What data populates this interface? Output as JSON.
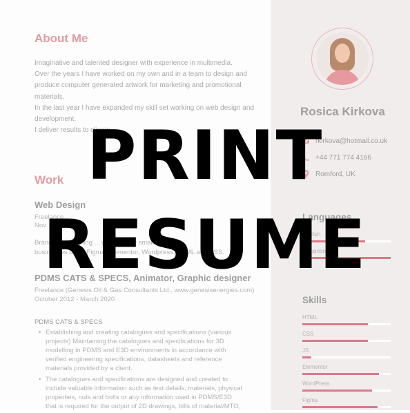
{
  "about": {
    "title": "About Me",
    "lines": [
      "Imaginative and talented designer with experience in multimedia.",
      "Over the years I have worked on my own and in a team to design and",
      "produce computer generated artwork for marketing and promotional",
      "materials.",
      "In the last year I have expanded my skill set working on web design and",
      "development.",
      "I deliver results to clients"
    ]
  },
  "work": {
    "title": "Work",
    "jobs": [
      {
        "title": "Web Design",
        "company": "Freelance",
        "dates": "Nov",
        "desc_lines": [
          "Branding, designing ... websites for small",
          "businesses using Figma, Elementor, Wordpress, HTML and CSS."
        ]
      },
      {
        "title": "PDMS CATS & SPECS, Animator, Graphic designer",
        "company": "Freelance (Genesis Oil & Gas Consultants Ltd., www.genesisenergies.com)",
        "dates": "October 2012 -  March 2020"
      }
    ],
    "bullets_heading": "PDMS CATS & SPECS",
    "bullets": [
      [
        "Establishing and creating catalogues and specifications (various",
        "projects) Maintaining the catalogues and specifications for 3D",
        "modelling in PDMS and E3D environments in accordance with",
        "verified engineering specifications, datasheets and reference",
        "materials provided by a client."
      ],
      [
        "The catalogues and specifications are designed and created to",
        "include valuable information such as text details, materials, physical",
        "properties, nuts and bolts or any information used in PDMS/E3D",
        "that is required for the output of 2D drawings, bills of material/MTO,"
      ]
    ]
  },
  "profile": {
    "name": "Rosica Kirkova",
    "email": "rkirkova@hotmail.co.uk",
    "phone": "+44 771 774 4166",
    "location": "Romford, UK",
    "accent": "#d97a87"
  },
  "languages": {
    "title": "Languages",
    "items": [
      {
        "label": "English",
        "level": 0.71
      },
      {
        "label": "Bulgarian",
        "level": 1.0
      }
    ]
  },
  "skills": {
    "title": "Skills",
    "items": [
      {
        "label": "HTML",
        "level": 0.74
      },
      {
        "label": "CSS",
        "level": 0.74
      },
      {
        "label": "JS",
        "level": 0.1
      },
      {
        "label": "Elementor",
        "level": 0.87
      },
      {
        "label": "WordPress",
        "level": 0.79
      },
      {
        "label": "Figma",
        "level": 0.85
      }
    ]
  },
  "overlay": {
    "line1": "PRINT",
    "line2": "RESUME"
  }
}
